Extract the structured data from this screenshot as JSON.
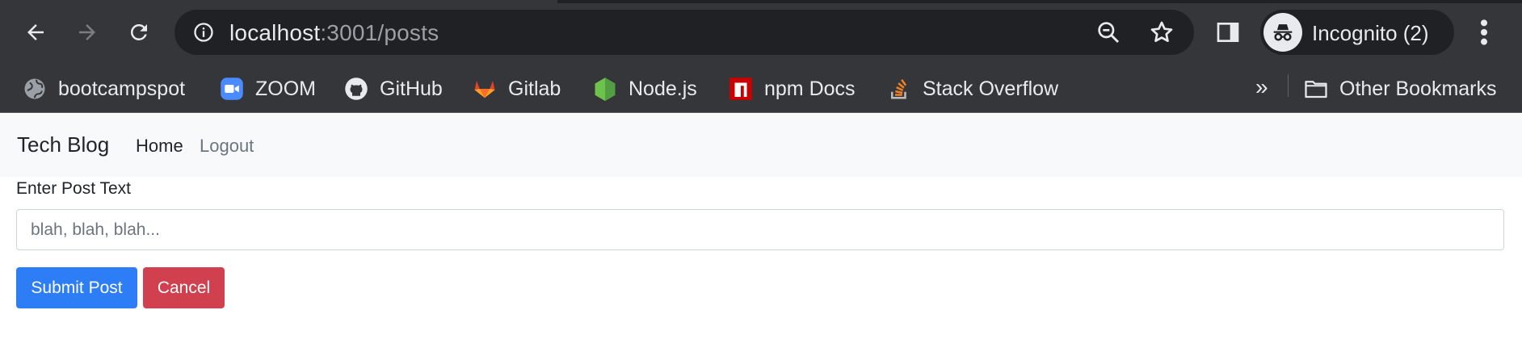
{
  "browser": {
    "url_host": "localhost",
    "url_path": ":3001/posts",
    "profile_label": "Incognito (2)",
    "bookmarks": [
      {
        "label": "bootcampspot",
        "icon": "globe-icon"
      },
      {
        "label": "ZOOM",
        "icon": "zoom-icon",
        "color": "#4a8cff"
      },
      {
        "label": "GitHub",
        "icon": "github-icon"
      },
      {
        "label": "Gitlab",
        "icon": "gitlab-icon",
        "color": "#e2432a"
      },
      {
        "label": "Node.js",
        "icon": "nodejs-icon",
        "color": "#6cc24a"
      },
      {
        "label": "npm Docs",
        "icon": "npm-icon",
        "color": "#cb0000"
      },
      {
        "label": "Stack Overflow",
        "icon": "stackoverflow-icon",
        "color": "#f48024"
      }
    ],
    "more_bookmarks": "»",
    "other_bookmarks": "Other Bookmarks"
  },
  "navbar": {
    "brand": "Tech Blog",
    "home": "Home",
    "logout": "Logout"
  },
  "form": {
    "label": "Enter Post Text",
    "placeholder": "blah, blah, blah...",
    "value": "",
    "submit": "Submit Post",
    "cancel": "Cancel"
  },
  "colors": {
    "primary": "#2d7df6",
    "danger": "#d1404e",
    "navbar_bg": "#f8f9fa",
    "chrome_bg": "#35363a"
  }
}
